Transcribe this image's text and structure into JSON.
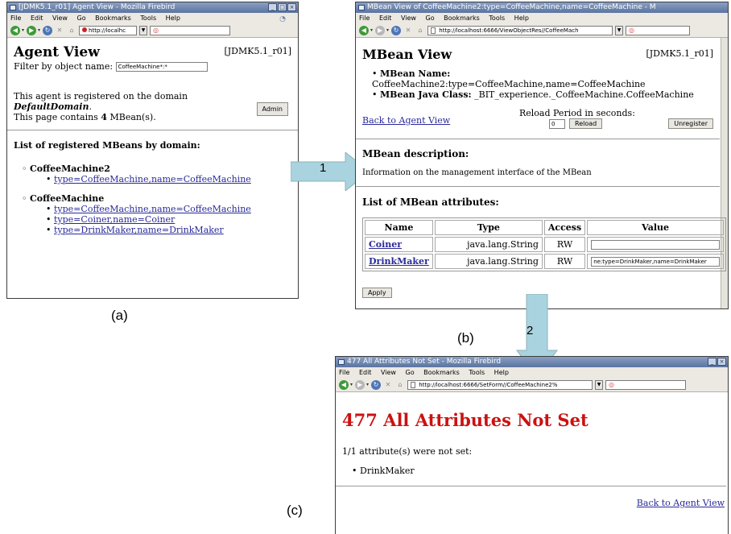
{
  "window_a": {
    "title": "[JDMK5.1_r01] Agent View - Mozilla Firebird",
    "menu": [
      "File",
      "Edit",
      "View",
      "Go",
      "Bookmarks",
      "Tools",
      "Help"
    ],
    "url": "http://localhc",
    "heading": "Agent View",
    "version": "[JDMK5.1_r01]",
    "filter_label": "Filter by object name:",
    "filter_value": "CoffeeMachine*:*",
    "domain_line1": "This agent is registered on the domain",
    "domain_name": "DefaultDomain",
    "domain_period": ".",
    "count_prefix": "This page contains",
    "count_value": "4",
    "count_suffix": "MBean(s).",
    "admin_label": "Admin",
    "list_heading": "List of registered MBeans by domain:",
    "domains": [
      {
        "name": "CoffeeMachine2",
        "mbeans": [
          "type=CoffeeMachine,name=CoffeeMachine"
        ]
      },
      {
        "name": "CoffeeMachine",
        "mbeans": [
          "type=CoffeeMachine,name=CoffeeMachine",
          "type=Coiner,name=Coiner",
          "type=DrinkMaker,name=DrinkMaker"
        ]
      }
    ],
    "caption": "(a)"
  },
  "window_b": {
    "title": "MBean View of CoffeeMachine2:type=CoffeeMachine,name=CoffeeMachine - M",
    "menu": [
      "File",
      "Edit",
      "View",
      "Go",
      "Bookmarks",
      "Tools",
      "Help"
    ],
    "url": "http://localhost:6666/ViewObjectRes//CoffeeMach",
    "heading": "MBean View",
    "version": "[JDMK5.1_r01]",
    "mbean_name_label": "MBean Name:",
    "mbean_name_value": "CoffeeMachine2:type=CoffeeMachine,name=CoffeeMachine",
    "java_class_label": "MBean Java Class:",
    "java_class_value": "_BIT_experience._CoffeeMachine.CoffeeMachine",
    "back_link": "Back to Agent View",
    "reload_label": "Reload Period in seconds:",
    "reload_value": "0",
    "reload_button": "Reload",
    "unregister_button": "Unregister",
    "description_heading": "MBean description:",
    "description_text": "Information on the management interface of the MBean",
    "attributes_heading": "List of MBean attributes:",
    "table_headers": [
      "Name",
      "Type",
      "Access",
      "Value"
    ],
    "rows": [
      {
        "name": "Coiner",
        "type": "java.lang.String",
        "access": "RW",
        "value": ""
      },
      {
        "name": "DrinkMaker",
        "type": "java.lang.String",
        "access": "RW",
        "value": "ne:type=DrinkMaker,name=DrinkMaker"
      }
    ],
    "apply_button": "Apply",
    "caption": "(b)"
  },
  "window_c": {
    "title": "477 All Attributes Not Set - Mozilla Firebird",
    "menu": [
      "File",
      "Edit",
      "View",
      "Go",
      "Bookmarks",
      "Tools",
      "Help"
    ],
    "url": "http://localhost:6666/SetForm//CoffeeMachine2%",
    "heading": "477 All Attributes Not Set",
    "message": "1/1 attribute(s) were not set:",
    "items": [
      "DrinkMaker"
    ],
    "back_link": "Back to Agent View",
    "caption": "(c)"
  },
  "arrows": [
    {
      "label": "1",
      "color": "#a9d4df"
    },
    {
      "label": "2",
      "color": "#a9d4df"
    }
  ],
  "colors": {
    "error_heading": "#cc1111",
    "link": "#2a2a9a",
    "arrow": "#a9d4df"
  }
}
